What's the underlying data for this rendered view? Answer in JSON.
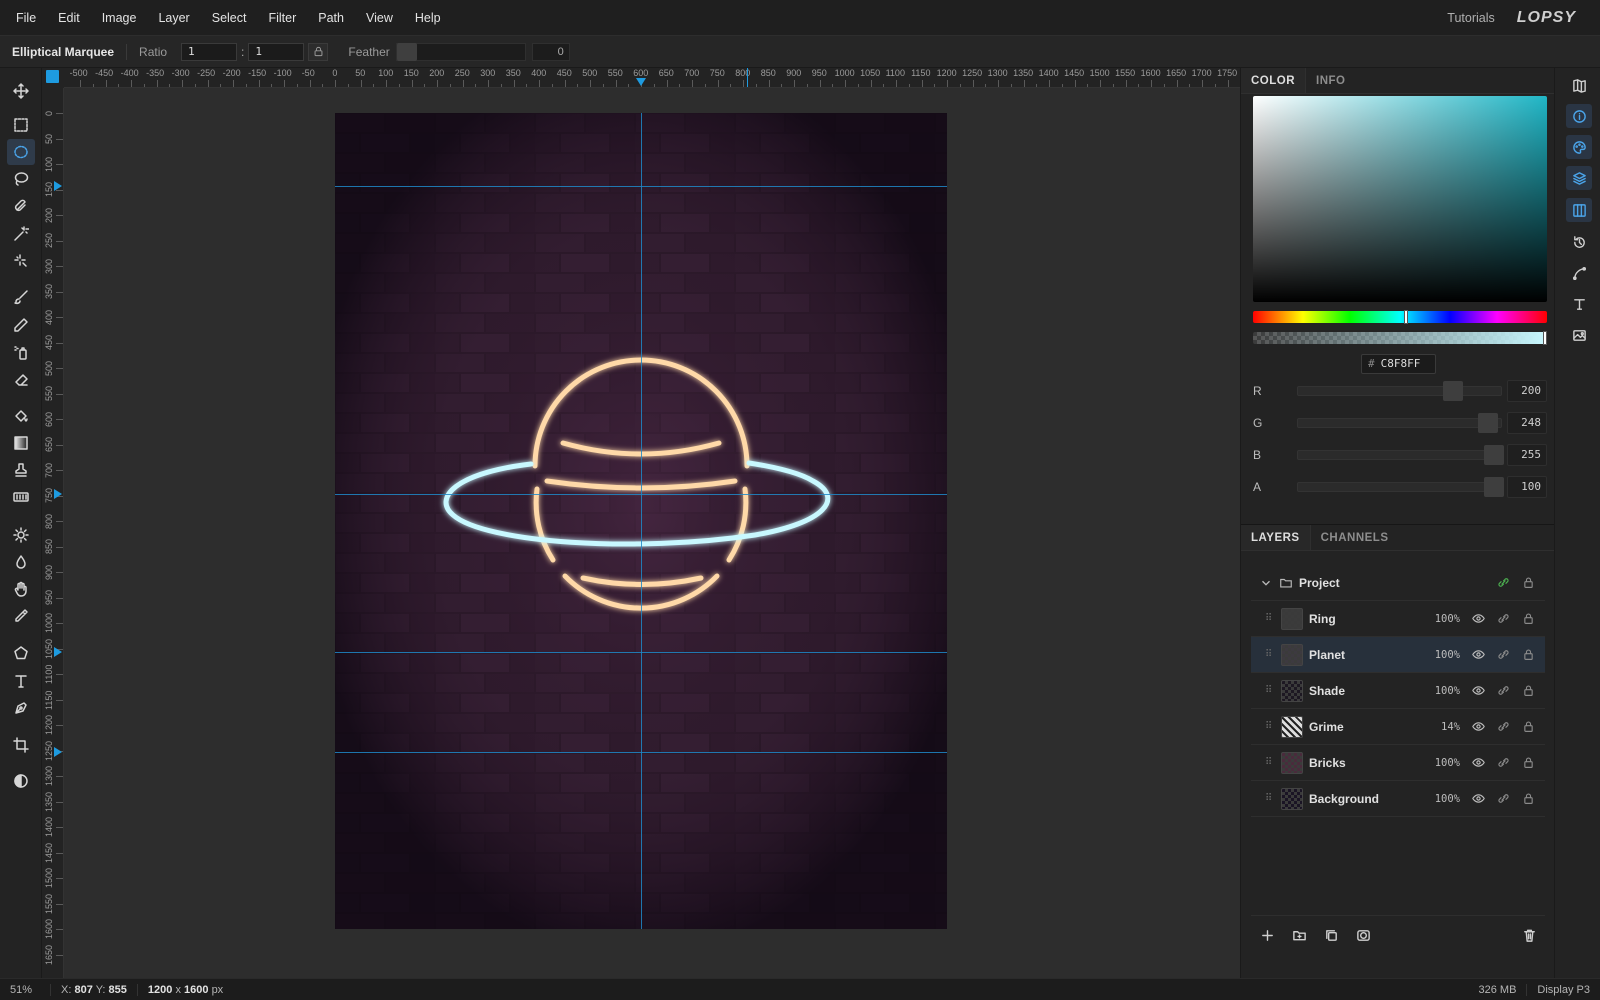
{
  "menu": {
    "items": [
      "File",
      "Edit",
      "Image",
      "Layer",
      "Select",
      "Filter",
      "Path",
      "View",
      "Help"
    ],
    "tutorials": "Tutorials",
    "logo": "LOPSY"
  },
  "options": {
    "tool_name": "Elliptical Marquee",
    "ratio_label": "Ratio",
    "ratio_w": "1",
    "ratio_sep": ":",
    "ratio_h": "1",
    "feather_label": "Feather",
    "feather_value": "0"
  },
  "tools": [
    {
      "name": "move-tool",
      "icon": "move-icon"
    },
    {
      "name": "rect-marquee-tool",
      "icon": "rect-marquee-icon"
    },
    {
      "name": "ellipse-marquee-tool",
      "icon": "ellipse-marquee-icon",
      "active": true
    },
    {
      "name": "lasso-tool",
      "icon": "lasso-icon"
    },
    {
      "name": "magnetic-lasso-tool",
      "icon": "magnetic-lasso-icon"
    },
    {
      "name": "magic-wand-tool",
      "icon": "magic-wand-icon"
    },
    {
      "name": "quick-select-tool",
      "icon": "quick-select-icon"
    },
    {
      "name": "brush-tool",
      "icon": "brush-icon"
    },
    {
      "name": "pencil-tool",
      "icon": "pencil-icon"
    },
    {
      "name": "spray-tool",
      "icon": "spray-icon"
    },
    {
      "name": "eraser-tool",
      "icon": "eraser-icon"
    },
    {
      "name": "fill-tool",
      "icon": "paint-bucket-icon"
    },
    {
      "name": "gradient-tool",
      "icon": "gradient-icon"
    },
    {
      "name": "clone-stamp-tool",
      "icon": "stamp-icon"
    },
    {
      "name": "pattern-tool",
      "icon": "pattern-icon"
    },
    {
      "name": "dodge-tool",
      "icon": "sun-icon"
    },
    {
      "name": "blur-tool",
      "icon": "drop-icon"
    },
    {
      "name": "hand-tool",
      "icon": "hand-icon"
    },
    {
      "name": "eyedropper-tool",
      "icon": "eyedropper-icon"
    },
    {
      "name": "shape-tool",
      "icon": "pentagon-icon"
    },
    {
      "name": "text-tool",
      "icon": "text-icon"
    },
    {
      "name": "pen-tool",
      "icon": "pen-icon"
    },
    {
      "name": "crop-tool",
      "icon": "crop-icon"
    },
    {
      "name": "mask-mode-tool",
      "icon": "contrast-icon"
    }
  ],
  "ruler": {
    "h_labels": [
      "-500",
      "-450",
      "-400",
      "-350",
      "-300",
      "-250",
      "-200",
      "-150",
      "-100",
      "-50",
      "0",
      "50",
      "100",
      "150",
      "200",
      "250",
      "300",
      "350",
      "400",
      "450",
      "500",
      "550",
      "600",
      "650",
      "700",
      "750",
      "800",
      "850",
      "900",
      "950",
      "1000",
      "1050",
      "1100",
      "1150",
      "1200",
      "1250",
      "1300",
      "1350",
      "1400",
      "1450",
      "1500",
      "1550",
      "1600",
      "1650",
      "1700",
      "1750"
    ],
    "v_labels": [
      "0",
      "50",
      "100",
      "150",
      "200",
      "250",
      "300",
      "350",
      "400",
      "450",
      "500",
      "550",
      "600",
      "650",
      "700",
      "750",
      "800",
      "850",
      "900",
      "950",
      "1000",
      "1050",
      "1100",
      "1150",
      "1200",
      "1250",
      "1300",
      "1350",
      "1400",
      "1450",
      "1500",
      "1550",
      "1600",
      "1650"
    ]
  },
  "color_panel": {
    "tabs": [
      "COLOR",
      "INFO"
    ],
    "hex_hash": "#",
    "hex": "C8F8FF",
    "hue_fraction": 0.52,
    "channels": [
      {
        "label": "R",
        "value": "200",
        "fraction": 0.78
      },
      {
        "label": "G",
        "value": "248",
        "fraction": 0.97
      },
      {
        "label": "B",
        "value": "255",
        "fraction": 1.0
      },
      {
        "label": "A",
        "value": "100",
        "fraction": 1.0
      }
    ],
    "colors": {
      "current": "#C8F8FF",
      "sv_hue": "#20b6c6"
    }
  },
  "layers_panel": {
    "tabs": [
      "LAYERS",
      "CHANNELS"
    ],
    "group": {
      "name": "Project"
    },
    "layers": [
      {
        "name": "Ring",
        "opacity": "100%",
        "thumb": "#3a3a3a",
        "selected": false
      },
      {
        "name": "Planet",
        "opacity": "100%",
        "thumb": "#3d3a40",
        "selected": true
      },
      {
        "name": "Shade",
        "opacity": "100%",
        "thumb": "#1d1822",
        "selected": false
      },
      {
        "name": "Grime",
        "opacity": "14%",
        "thumb": "#cfcfcf",
        "selected": false
      },
      {
        "name": "Bricks",
        "opacity": "100%",
        "thumb": "#4a2b3c",
        "selected": false
      },
      {
        "name": "Background",
        "opacity": "100%",
        "thumb": "#1a1424",
        "selected": false
      }
    ]
  },
  "side_icons": [
    {
      "name": "map-icon",
      "active": false
    },
    {
      "name": "info-icon",
      "active": true
    },
    {
      "name": "palette-icon",
      "active": true
    },
    {
      "name": "layers-icon",
      "active": true
    },
    {
      "name": "columns-icon",
      "active": true
    },
    {
      "name": "history-icon",
      "active": false
    },
    {
      "name": "curve-icon",
      "active": false
    },
    {
      "name": "text-style-icon",
      "active": false
    },
    {
      "name": "image-icon",
      "active": false
    }
  ],
  "status": {
    "zoom": "51%",
    "x_label": "X:",
    "x": "807",
    "y_label": "Y:",
    "y": "855",
    "dims_w": "1200",
    "dims_sep": "x",
    "dims_h": "1600",
    "dims_unit": "px",
    "memory": "326 MB",
    "profile": "Display P3"
  }
}
